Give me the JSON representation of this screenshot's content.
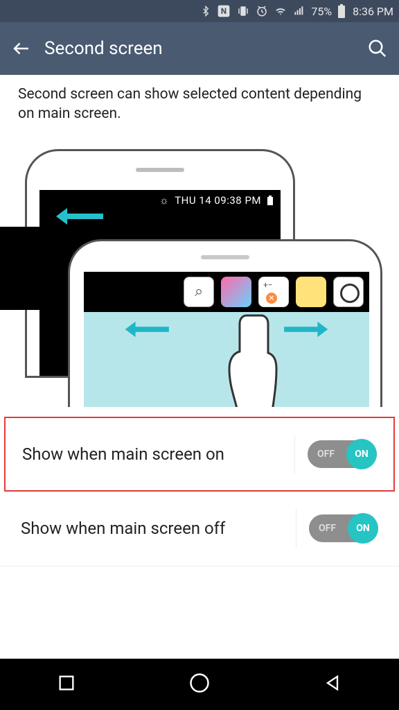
{
  "status": {
    "battery_pct": "75%",
    "time": "8:36 PM"
  },
  "header": {
    "title": "Second screen"
  },
  "description": "Second screen can show selected content depending on main screen.",
  "illustration": {
    "sec_screen_text": "THU 14  09:38 PM"
  },
  "settings": [
    {
      "label": "Show when main screen on",
      "off_text": "OFF",
      "on_text": "ON",
      "highlight": true
    },
    {
      "label": "Show when main screen off",
      "off_text": "OFF",
      "on_text": "ON",
      "highlight": false
    }
  ]
}
